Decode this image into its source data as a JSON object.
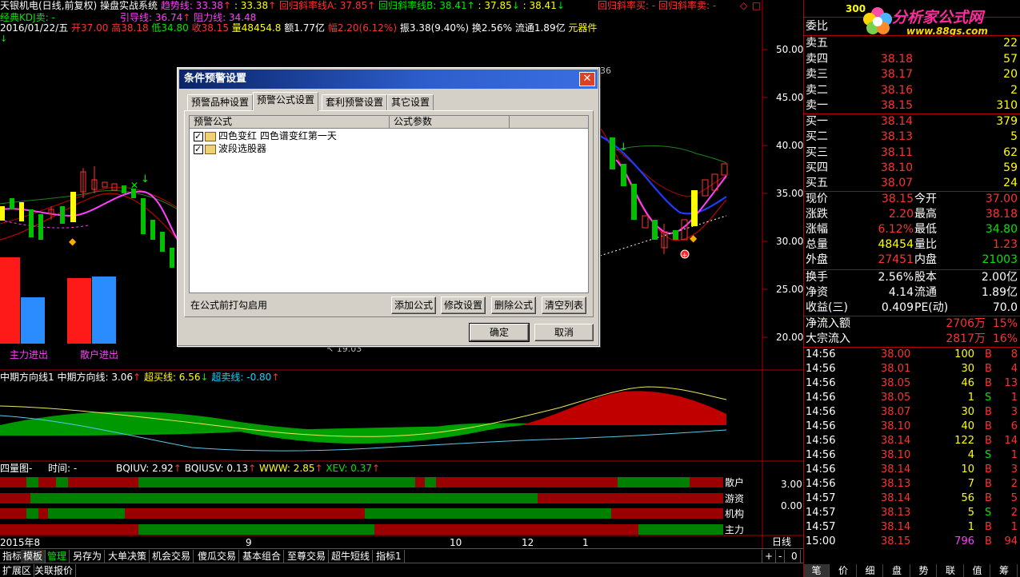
{
  "chart_header": {
    "line1_title": "天银机电(日线,前复权) 操盘实战系统",
    "trend_label": "趋势线: 33.38",
    "trend_val2": ": 33.38",
    "reg_a": "回归斜率线A: 37.85",
    "reg_b": "回归斜率线B: 38.41",
    "reg_b2": ": 37.85",
    "reg_b3": ": 38.41",
    "reg_buy": "回归斜率买: -",
    "reg_sell": "回归斜率卖: -",
    "line2_kdj": "经典KDJ卖: -",
    "guide": "引导线: 36.74",
    "resist": "阻力线: 34.48",
    "date": "2016/01/22/五",
    "open": "开37.00",
    "high": "高38.18",
    "low": "低34.80",
    "close": "收38.15",
    "vol": "量48454.8",
    "amt": "额1.77亿",
    "chg": "幅2.20(6.12%)",
    "amp": "振3.38(9.40%)",
    "turn": "换2.56%",
    "float": "流通1.89亿",
    "yuan": "元器件"
  },
  "price_axis": [
    "50.00",
    "45.00",
    "40.00",
    "35.00",
    "30.00",
    "25.00",
    "20.00"
  ],
  "main_labels": {
    "main_in": "主力进出",
    "retail_in": "散户进出",
    "partial_low": "19.03",
    "partial_top": "36"
  },
  "mid_indicator": {
    "name": "中期方向线1",
    "mid": "中期方向线: 3.06",
    "buy": "超买线: 6.56",
    "sell": "超卖线: -0.80"
  },
  "quad_indicator": {
    "name": "四量图-",
    "time": "时间: -",
    "bq": "BQIUV: 2.92",
    "bqs": "BQIUSV: 0.13",
    "www": "WWW: 2.85",
    "xev": "XEV: 0.37",
    "rows": [
      "散户",
      "游资",
      "机构",
      "主力"
    ],
    "axis": [
      "3.00",
      "0.00"
    ]
  },
  "date_axis": {
    "start": "2015年8",
    "m9": "9",
    "m10": "10",
    "m12": "12",
    "m1": "1",
    "period": "日线"
  },
  "bottom_tabs": [
    "指标",
    "模板",
    "管理",
    "另存为",
    "大单决策",
    "机会交易",
    "傻瓜交易",
    "基本组合",
    "至尊交易",
    "超牛短线",
    "指标1"
  ],
  "bottom_tabs2": [
    "扩展区",
    "关联报价"
  ],
  "zoom": {
    "plus": "+",
    "minus": "-",
    "zero": "0"
  },
  "right_tabs": [
    "笔",
    "价",
    "细",
    "盘",
    "势",
    "联",
    "值",
    "筹"
  ],
  "logo": {
    "title": "分析家公式网",
    "url": "www.88gs.com",
    "code": "300"
  },
  "order_book": {
    "committee_label": "委比",
    "sells": [
      {
        "label": "卖五",
        "price": "",
        "vol": "22"
      },
      {
        "label": "卖四",
        "price": "38.18",
        "vol": "57"
      },
      {
        "label": "卖三",
        "price": "38.17",
        "vol": "20"
      },
      {
        "label": "卖二",
        "price": "38.16",
        "vol": "2"
      },
      {
        "label": "卖一",
        "price": "38.15",
        "vol": "310"
      }
    ],
    "buys": [
      {
        "label": "买一",
        "price": "38.14",
        "vol": "379"
      },
      {
        "label": "买二",
        "price": "38.13",
        "vol": "5"
      },
      {
        "label": "买三",
        "price": "38.11",
        "vol": "62"
      },
      {
        "label": "买四",
        "price": "38.10",
        "vol": "59"
      },
      {
        "label": "买五",
        "price": "38.07",
        "vol": "24"
      }
    ]
  },
  "quote": [
    {
      "l1": "现价",
      "v1": "38.15",
      "l2": "今开",
      "v2": "37.00"
    },
    {
      "l1": "涨跌",
      "v1": "2.20",
      "l2": "最高",
      "v2": "38.18"
    },
    {
      "l1": "涨幅",
      "v1": "6.12%",
      "l2": "最低",
      "v2": "34.80"
    },
    {
      "l1": "总量",
      "v1": "48454",
      "l2": "量比",
      "v2": "1.23"
    },
    {
      "l1": "外盘",
      "v1": "27451",
      "l2": "内盘",
      "v2": "21003"
    }
  ],
  "fund": [
    {
      "l1": "换手",
      "v1": "2.56%",
      "l2": "股本",
      "v2": "2.00亿"
    },
    {
      "l1": "净资",
      "v1": "4.14",
      "l2": "流通",
      "v2": "1.89亿"
    },
    {
      "l1": "收益(三)",
      "v1": "0.409",
      "l2": "PE(动)",
      "v2": "70.0"
    }
  ],
  "flow": [
    {
      "label": "净流入额",
      "amt": "2706万",
      "pct": "15%"
    },
    {
      "label": "大宗流入",
      "amt": "2817万",
      "pct": "16%"
    }
  ],
  "ticks": [
    {
      "t": "14:56",
      "p": "38.00",
      "v": "100",
      "s": "B",
      "n": "8"
    },
    {
      "t": "14:56",
      "p": "38.01",
      "v": "30",
      "s": "B",
      "n": "4"
    },
    {
      "t": "14:56",
      "p": "38.05",
      "v": "46",
      "s": "B",
      "n": "13"
    },
    {
      "t": "14:56",
      "p": "38.05",
      "v": "1",
      "s": "S",
      "n": "1"
    },
    {
      "t": "14:56",
      "p": "38.07",
      "v": "30",
      "s": "B",
      "n": "3"
    },
    {
      "t": "14:56",
      "p": "38.10",
      "v": "40",
      "s": "B",
      "n": "6"
    },
    {
      "t": "14:56",
      "p": "38.14",
      "v": "122",
      "s": "B",
      "n": "14"
    },
    {
      "t": "14:56",
      "p": "38.10",
      "v": "4",
      "s": "S",
      "n": "1"
    },
    {
      "t": "14:56",
      "p": "38.14",
      "v": "10",
      "s": "B",
      "n": "3"
    },
    {
      "t": "14:56",
      "p": "38.13",
      "v": "7",
      "s": "B",
      "n": "2"
    },
    {
      "t": "14:57",
      "p": "38.14",
      "v": "56",
      "s": "B",
      "n": "5"
    },
    {
      "t": "14:57",
      "p": "38.13",
      "v": "5",
      "s": "S",
      "n": "2"
    },
    {
      "t": "14:57",
      "p": "38.14",
      "v": "1",
      "s": "B",
      "n": "1"
    },
    {
      "t": "15:00",
      "p": "38.15",
      "v": "796",
      "s": "B",
      "n": "94"
    }
  ],
  "dialog": {
    "title": "条件预警设置",
    "tabs": [
      "预警品种设置",
      "预警公式设置",
      "套利预警设置",
      "其它设置"
    ],
    "col_formula": "预警公式",
    "col_params": "公式参数",
    "items": [
      "四色变红  四色谱变红第一天",
      "波段选股器"
    ],
    "hint": "在公式前打勾启用",
    "btn_add": "添加公式",
    "btn_edit": "修改设置",
    "btn_del": "删除公式",
    "btn_clear": "清空列表",
    "btn_ok": "确定",
    "btn_cancel": "取消"
  }
}
